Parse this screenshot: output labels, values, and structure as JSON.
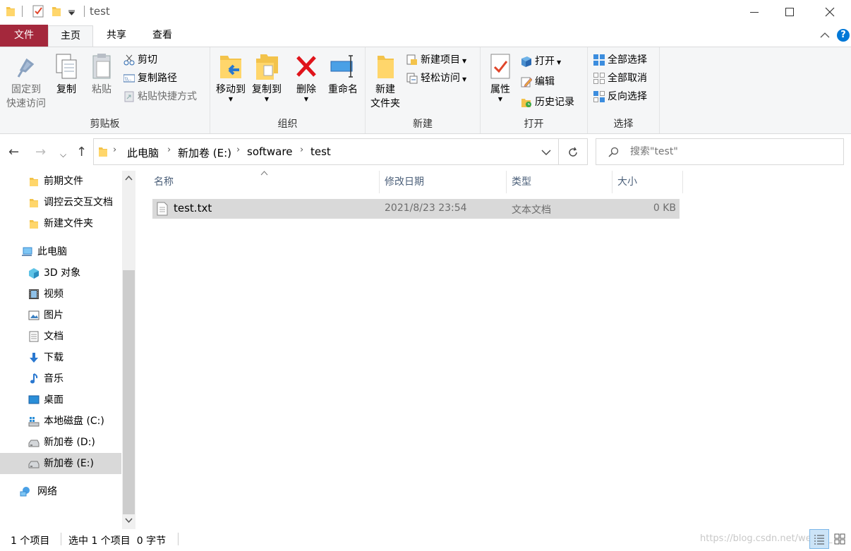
{
  "titlebar": {
    "title": "test"
  },
  "tabs": {
    "file": "文件",
    "home": "主页",
    "share": "共享",
    "view": "查看"
  },
  "ribbon": {
    "clipboard": {
      "pin_line1": "固定到",
      "pin_line2": "快速访问",
      "copy": "复制",
      "paste": "粘贴",
      "cut": "剪切",
      "copy_path": "复制路径",
      "paste_shortcut": "粘贴快捷方式",
      "label": "剪贴板"
    },
    "organize": {
      "move_to": "移动到",
      "copy_to": "复制到",
      "delete": "删除",
      "rename": "重命名",
      "label": "组织"
    },
    "new": {
      "new_folder_line1": "新建",
      "new_folder_line2": "文件夹",
      "new_item": "新建项目",
      "easy_access": "轻松访问",
      "label": "新建"
    },
    "open": {
      "properties": "属性",
      "open": "打开",
      "edit": "编辑",
      "history": "历史记录",
      "label": "打开"
    },
    "select": {
      "select_all": "全部选择",
      "select_none": "全部取消",
      "invert": "反向选择",
      "label": "选择"
    }
  },
  "address": {
    "crumbs": [
      "此电脑",
      "新加卷 (E:)",
      "software",
      "test"
    ]
  },
  "search": {
    "placeholder": "搜索\"test\""
  },
  "nav": {
    "items": [
      "前期文件",
      "调控云交互文档",
      "新建文件夹",
      "此电脑",
      "3D 对象",
      "视频",
      "图片",
      "文档",
      "下载",
      "音乐",
      "桌面",
      "本地磁盘 (C:)",
      "新加卷 (D:)",
      "新加卷 (E:)",
      "网络"
    ]
  },
  "columns": {
    "name": "名称",
    "modified": "修改日期",
    "type": "类型",
    "size": "大小"
  },
  "files": [
    {
      "name": "test.txt",
      "modified": "2021/8/23 23:54",
      "type": "文本文档",
      "size": "0 KB"
    }
  ],
  "status": {
    "count": "1 个项目",
    "selected": "选中 1 个项目  0 字节",
    "watermark": "https://blog.csdn.net/weixin_"
  },
  "colors": {
    "file_tab": "#a4283c",
    "selection": "#d9d9d9",
    "header_text": "#4c607a",
    "accent": "#0078d7"
  }
}
